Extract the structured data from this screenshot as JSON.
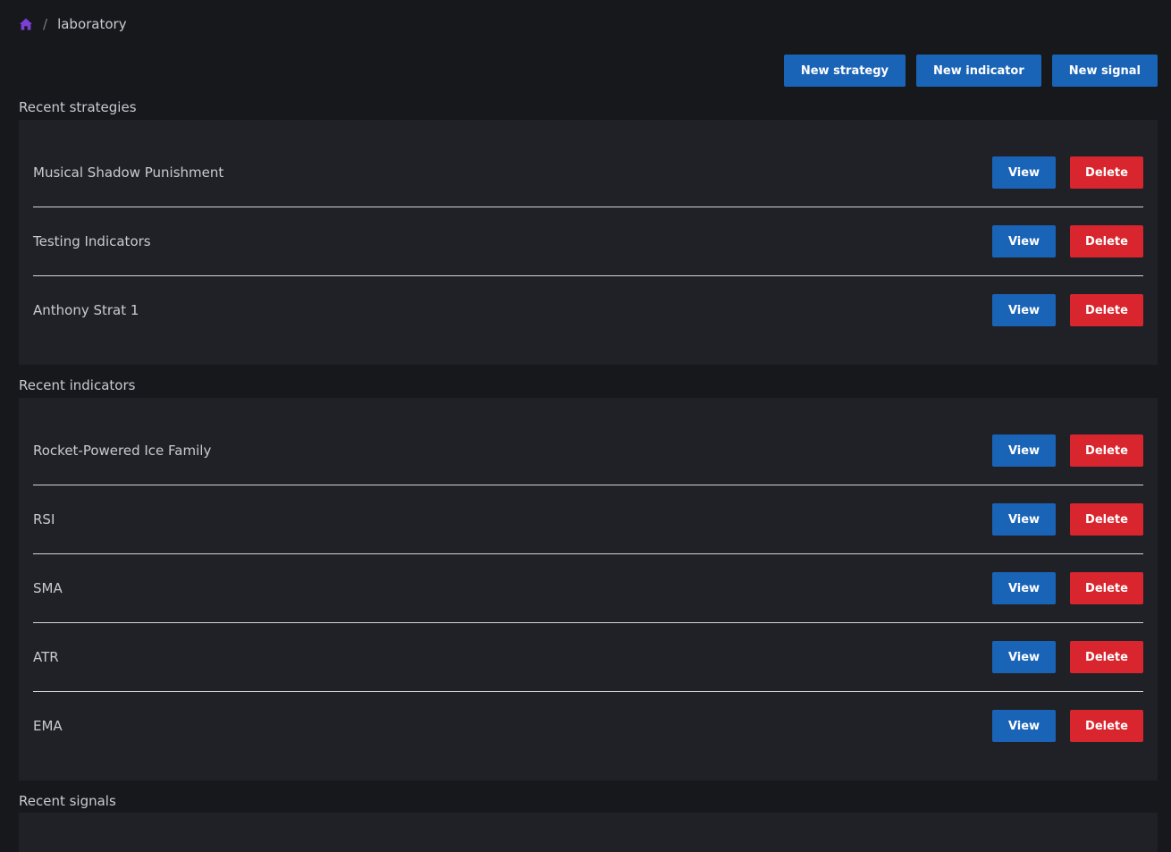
{
  "breadcrumb": {
    "home_icon": "home-icon",
    "separator": "/",
    "current": "laboratory"
  },
  "toolbar": {
    "new_strategy": "New strategy",
    "new_indicator": "New indicator",
    "new_signal": "New signal"
  },
  "sections": {
    "strategies": {
      "title": "Recent strategies",
      "items": [
        {
          "name": "Musical Shadow Punishment",
          "view": "View",
          "delete": "Delete"
        },
        {
          "name": "Testing Indicators",
          "view": "View",
          "delete": "Delete"
        },
        {
          "name": "Anthony Strat 1",
          "view": "View",
          "delete": "Delete"
        }
      ]
    },
    "indicators": {
      "title": "Recent indicators",
      "items": [
        {
          "name": "Rocket-Powered Ice Family",
          "view": "View",
          "delete": "Delete"
        },
        {
          "name": "RSI",
          "view": "View",
          "delete": "Delete"
        },
        {
          "name": "SMA",
          "view": "View",
          "delete": "Delete"
        },
        {
          "name": "ATR",
          "view": "View",
          "delete": "Delete"
        },
        {
          "name": "EMA",
          "view": "View",
          "delete": "Delete"
        }
      ]
    },
    "signals": {
      "title": "Recent signals",
      "items": []
    }
  },
  "colors": {
    "background": "#17181c",
    "panel": "#202126",
    "primary": "#1a64b8",
    "danger": "#d9262e",
    "home_icon": "#7b3fd6"
  }
}
